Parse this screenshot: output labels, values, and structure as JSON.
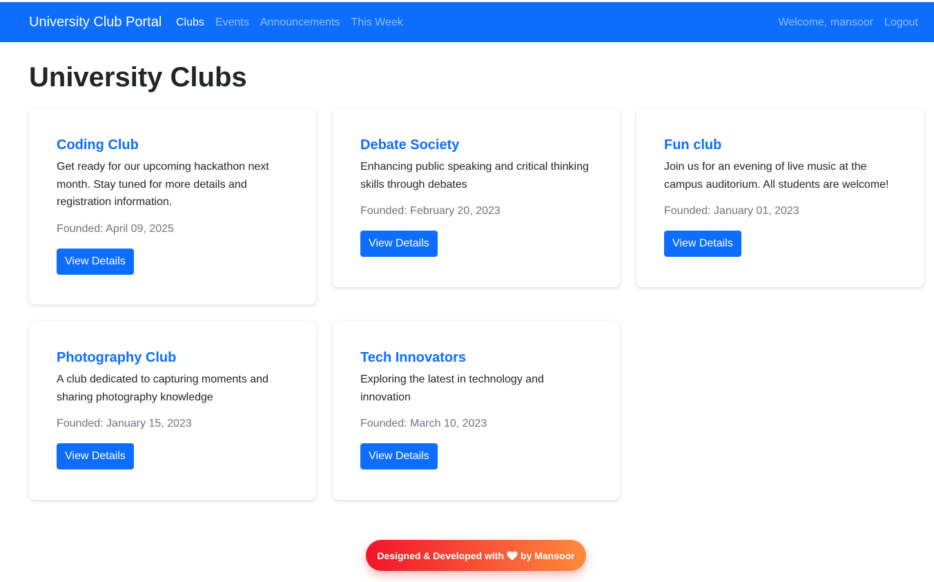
{
  "navbar": {
    "brand": "University Club Portal",
    "links": [
      {
        "label": "Clubs",
        "active": true
      },
      {
        "label": "Events",
        "active": false
      },
      {
        "label": "Announcements",
        "active": false
      },
      {
        "label": "This Week",
        "active": false
      }
    ],
    "welcome": "Welcome, mansoor",
    "logout": "Logout"
  },
  "page": {
    "title": "University Clubs"
  },
  "clubs": [
    {
      "name": "Coding Club",
      "description": "Get ready for our upcoming hackathon next month. Stay tuned for more details and registration information.",
      "founded": "Founded: April 09, 2025",
      "button": "View Details"
    },
    {
      "name": "Debate Society",
      "description": "Enhancing public speaking and critical thinking skills through debates",
      "founded": "Founded: February 20, 2023",
      "button": "View Details"
    },
    {
      "name": "Fun club",
      "description": "Join us for an evening of live music at the campus auditorium. All students are welcome!",
      "founded": "Founded: January 01, 2023",
      "button": "View Details"
    },
    {
      "name": "Photography Club",
      "description": "A club dedicated to capturing moments and sharing photography knowledge",
      "founded": "Founded: January 15, 2023",
      "button": "View Details"
    },
    {
      "name": "Tech Innovators",
      "description": "Exploring the latest in technology and innovation",
      "founded": "Founded: March 10, 2023",
      "button": "View Details"
    }
  ],
  "footer": {
    "before": "Designed & Developed with",
    "icon": "heart-icon",
    "after": "by Mansoor"
  },
  "colors": {
    "primary": "#0d6efd",
    "muted": "#6c757d",
    "footer_gradient_start": "#f0152b",
    "footer_gradient_end": "#ff8a3c"
  }
}
